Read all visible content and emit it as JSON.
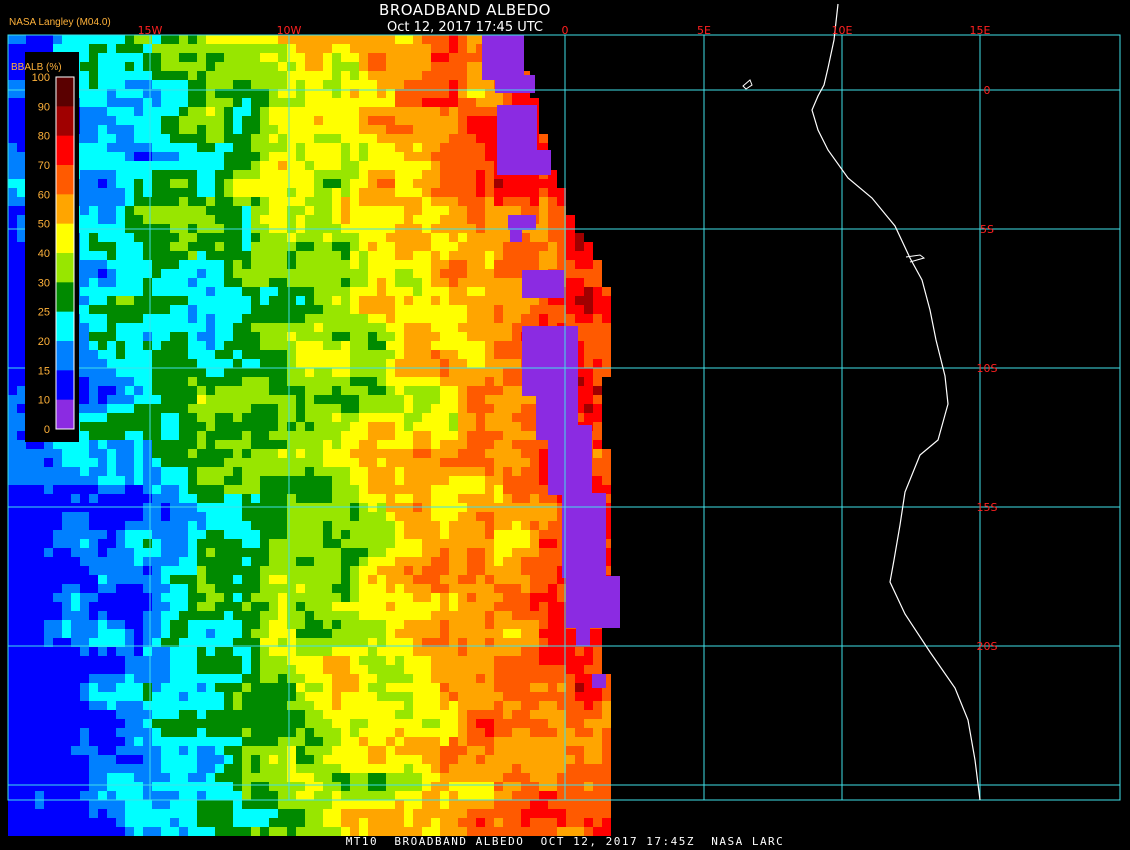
{
  "header": {
    "title": "BROADBAND ALBEDO",
    "datetime": "Oct 12, 2017 17:45 UTC",
    "producer": "NASA Langley (M04.0)"
  },
  "footer": {
    "caption": "MT10  BROADBAND ALBEDO  OCT 12, 2017 17:45Z  NASA LARC"
  },
  "legend": {
    "title": "BBALB (%)",
    "ticks": [
      "100",
      "90",
      "80",
      "70",
      "60",
      "50",
      "40",
      "30",
      "25",
      "20",
      "15",
      "10",
      "0"
    ],
    "colors": [
      "#5a0000",
      "#a00000",
      "#ff0000",
      "#ff5a00",
      "#ffa500",
      "#ffff00",
      "#98e600",
      "#008a00",
      "#00ffff",
      "#0080ff",
      "#0000ff",
      "#8b2be2"
    ]
  },
  "map": {
    "lon_labels": [
      "15W",
      "10W",
      "0",
      "5E",
      "10E",
      "15E"
    ],
    "lat_labels": [
      "0",
      "5S",
      "10S",
      "15S",
      "20S"
    ],
    "grid_color": "#40e0e8",
    "label_color": "#ff2020",
    "coast_color": "#ffffff",
    "nodata_color": "#8b2be2"
  }
}
